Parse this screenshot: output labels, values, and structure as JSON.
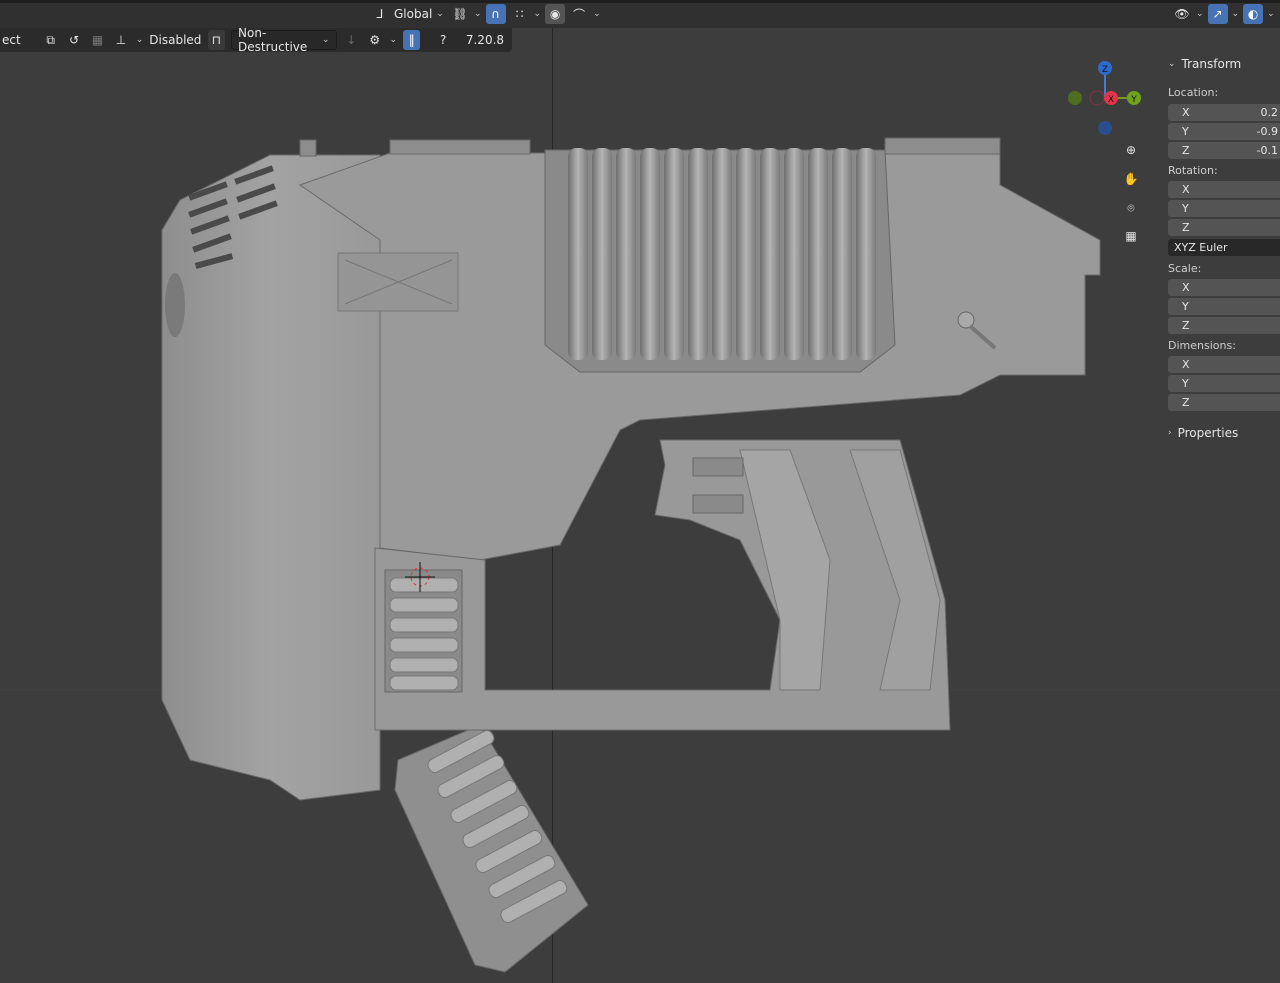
{
  "header": {
    "orientation_label": "Global",
    "colors": {
      "accent": "#4772b3",
      "header_bg": "#303030",
      "viewport_bg": "#3d3d3d"
    }
  },
  "tool_options": {
    "mode_label": "ect",
    "snap_label": "Disabled",
    "mode_dropdown": "Non-Destructive",
    "version": "7.20.8"
  },
  "gizmo": {
    "z": "Z",
    "x": "X",
    "y": "Y"
  },
  "n_panel": {
    "title": "Transform",
    "location_label": "Location:",
    "location": [
      {
        "axis": "X",
        "value": "0.2"
      },
      {
        "axis": "Y",
        "value": "-0.9"
      },
      {
        "axis": "Z",
        "value": "-0.1"
      }
    ],
    "rotation_label": "Rotation:",
    "rotation": [
      {
        "axis": "X",
        "value": ""
      },
      {
        "axis": "Y",
        "value": ""
      },
      {
        "axis": "Z",
        "value": ""
      }
    ],
    "rotation_mode": "XYZ Euler",
    "scale_label": "Scale:",
    "scale": [
      {
        "axis": "X",
        "value": ""
      },
      {
        "axis": "Y",
        "value": ""
      },
      {
        "axis": "Z",
        "value": ""
      }
    ],
    "dimensions_label": "Dimensions:",
    "dimensions": [
      {
        "axis": "X",
        "value": ""
      },
      {
        "axis": "Y",
        "value": ""
      },
      {
        "axis": "Z",
        "value": ""
      }
    ],
    "properties_label": "Properties"
  }
}
